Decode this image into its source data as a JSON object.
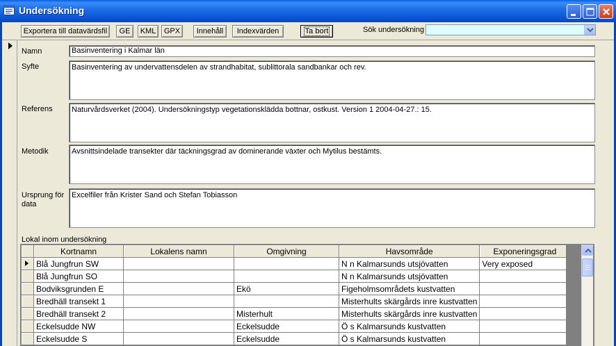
{
  "window": {
    "title": "Undersökning",
    "controls": {
      "minimize": "minimize",
      "maximize": "maximize",
      "close": "close"
    }
  },
  "toolbar": {
    "export_label": "Exportera till datavärdsfil",
    "ge_label": "GE",
    "kml_label": "KML",
    "gpx_label": "GPX",
    "innehall_label": "Innehåll",
    "indexvarden_label": "Indexvärden",
    "tabort_label": "Ta bort",
    "search_label": "Sök undersökning",
    "search_value": ""
  },
  "form": {
    "namn_label": "Namn",
    "namn_value": "Basinventering i Kalmar län",
    "syfte_label": "Syfte",
    "syfte_value": "Basinventering av undervattensdelen av strandhabitat, sublittorala sandbankar och rev.",
    "referens_label": "Referens",
    "referens_value": "Naturvårdsverket (2004). Undersökningstyp vegetationsklädda bottnar, ostkust. Version 1 2004-04-27.: 15.",
    "metodik_label": "Metodik",
    "metodik_value": "Avsnittsindelade transekter där täckningsgrad av dominerande växter och Mytilus bestämts.",
    "ursprung_label": "Ursprung för data",
    "ursprung_value": "Excelfiler från Krister Sand och Stefan Tobiasson"
  },
  "subform": {
    "label": "Lokal inom undersökning",
    "columns": [
      "Kortnamn",
      "Lokalens namn",
      "Omgivning",
      "Havsområde",
      "Exponeringsgrad"
    ],
    "rows": [
      [
        "Blå Jungfrun SW",
        "",
        "",
        "N n Kalmarsunds utsjövatten",
        "Very exposed"
      ],
      [
        "Blå Jungfrun SO",
        "",
        "",
        "N n Kalmarsunds utsjövatten",
        ""
      ],
      [
        "Bodviksgrunden E",
        "",
        "Ekö",
        "Figeholmsområdets kustvatten",
        ""
      ],
      [
        "Bredhäll transekt 1",
        "",
        "",
        "Misterhults skärgårds inre kustvatten",
        ""
      ],
      [
        "Bredhäll transekt 2",
        "",
        "Misterhult",
        "Misterhults skärgårds inre kustvatten",
        ""
      ],
      [
        "Eckelsudde NW",
        "",
        "Eckelsudde",
        "Ö s Kalmarsunds kustvatten",
        ""
      ],
      [
        "Eckelsudde S",
        "",
        "Eckelsudde",
        "Ö s Kalmarsunds kustvatten",
        ""
      ]
    ]
  }
}
